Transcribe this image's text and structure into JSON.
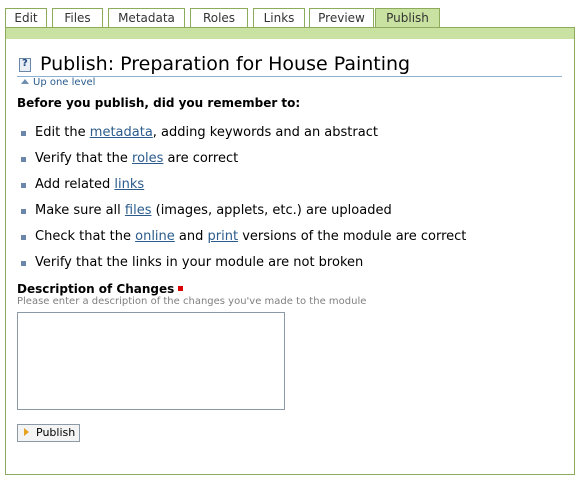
{
  "tabs": [
    {
      "label": "Edit",
      "active": false
    },
    {
      "label": "Files",
      "active": false
    },
    {
      "label": "Metadata",
      "active": false
    },
    {
      "label": "Roles",
      "active": false
    },
    {
      "label": "Links",
      "active": false
    },
    {
      "label": "Preview",
      "active": false
    },
    {
      "label": "Publish",
      "active": true
    }
  ],
  "page": {
    "title": "Publish: Preparation for House Painting",
    "up_level": "Up one level",
    "intro": "Before you publish, did you remember to:"
  },
  "checklist": [
    {
      "pre": "Edit the ",
      "link": "metadata",
      "post": ", adding keywords and an abstract"
    },
    {
      "pre": "Verify that the ",
      "link": "roles",
      "post": " are correct"
    },
    {
      "pre": "Add related ",
      "link": "links",
      "post": ""
    },
    {
      "pre": "Make sure all ",
      "link": "files",
      "post": " (images, applets, etc.) are uploaded"
    },
    {
      "pre": "Check that the ",
      "link": "online",
      "mid": " and ",
      "link2": "print",
      "post": " versions of the module are correct"
    },
    {
      "pre": "Verify that the links in your module are not broken"
    }
  ],
  "form": {
    "label": "Description of Changes",
    "hint": "Please enter a description of the changes you've made to the module",
    "value": "",
    "button": "Publish"
  },
  "colors": {
    "tab_active": "#c9e2a1",
    "border": "#8cac5c",
    "link": "#2a5b8c",
    "required": "#dd0000",
    "button_icon": "#e6a221"
  },
  "icons": {
    "title": "help-doc-icon",
    "up_level": "up-arrow-icon",
    "required": "required-marker-icon",
    "button": "arrow-right-icon"
  }
}
